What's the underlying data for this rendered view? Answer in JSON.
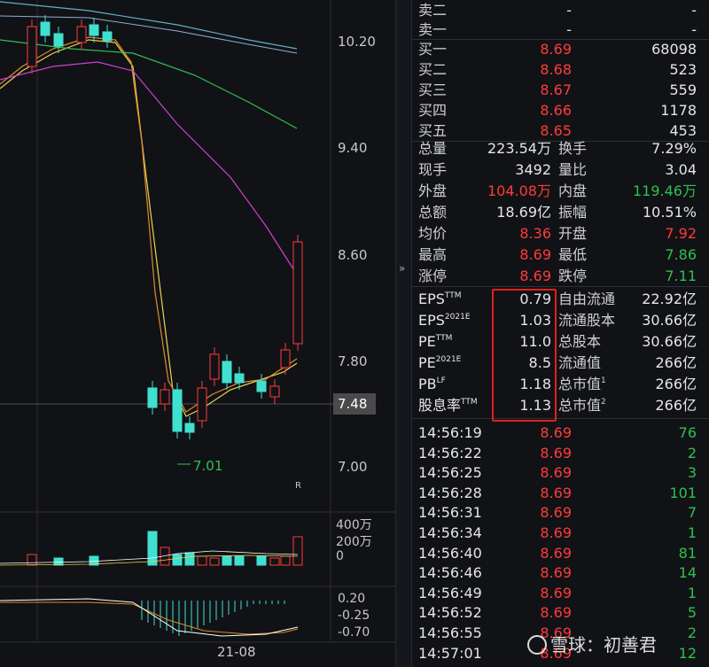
{
  "chart": {
    "price_axis": [
      "10.20",
      "9.40",
      "8.60",
      "7.80",
      "7.00"
    ],
    "current_price": "7.48",
    "low_marker": "7.01",
    "r_mark": "R",
    "volume_axis": [
      "400万",
      "200万",
      "0"
    ],
    "macd_axis": [
      "0.20",
      "-0.25",
      "-0.70"
    ],
    "date": "21-08",
    "colors": {
      "up": "#ff3b3b",
      "down": "#40e0d0",
      "ma5": "#ffffff",
      "ma10": "#e8d44d",
      "ma20": "#d040d0",
      "ma60": "#2ec14f",
      "ma_long": "#5fb0c8"
    }
  },
  "expand_icon": "»",
  "order_book": {
    "asks": [
      {
        "label": "卖二",
        "price": "-",
        "volume": "-"
      },
      {
        "label": "卖一",
        "price": "-",
        "volume": "-"
      }
    ],
    "bids": [
      {
        "label": "买一",
        "price": "8.69",
        "volume": "68098"
      },
      {
        "label": "买二",
        "price": "8.68",
        "volume": "523"
      },
      {
        "label": "买三",
        "price": "8.67",
        "volume": "559"
      },
      {
        "label": "买四",
        "price": "8.66",
        "volume": "1178"
      },
      {
        "label": "买五",
        "price": "8.65",
        "volume": "453"
      }
    ]
  },
  "stats": [
    {
      "l1": "总量",
      "v1": "223.54万",
      "c1": "white",
      "l2": "换手",
      "v2": "7.29%",
      "c2": "white"
    },
    {
      "l1": "现手",
      "v1": "3492",
      "c1": "white",
      "l2": "量比",
      "v2": "3.04",
      "c2": "white"
    },
    {
      "l1": "外盘",
      "v1": "104.08万",
      "c1": "red",
      "l2": "内盘",
      "v2": "119.46万",
      "c2": "green"
    },
    {
      "l1": "总额",
      "v1": "18.69亿",
      "c1": "white",
      "l2": "振幅",
      "v2": "10.51%",
      "c2": "white"
    },
    {
      "l1": "均价",
      "v1": "8.36",
      "c1": "red",
      "l2": "开盘",
      "v2": "7.92",
      "c2": "red"
    },
    {
      "l1": "最高",
      "v1": "8.69",
      "c1": "red",
      "l2": "最低",
      "v2": "7.86",
      "c2": "green"
    },
    {
      "l1": "涨停",
      "v1": "8.69",
      "c1": "red",
      "l2": "跌停",
      "v2": "7.11",
      "c2": "green"
    }
  ],
  "fundamentals": [
    {
      "l1": "EPS",
      "s1": "TTM",
      "v1": "0.79",
      "l2": "自由流通",
      "s2": "",
      "v2": "22.92亿"
    },
    {
      "l1": "EPS",
      "s1": "2021E",
      "v1": "1.03",
      "l2": "流通股本",
      "s2": "",
      "v2": "30.66亿"
    },
    {
      "l1": "PE",
      "s1": "TTM",
      "v1": "11.0",
      "l2": "总股本",
      "s2": "",
      "v2": "30.66亿"
    },
    {
      "l1": "PE",
      "s1": "2021E",
      "v1": "8.5",
      "l2": "流通值",
      "s2": "",
      "v2": "266亿"
    },
    {
      "l1": "PB",
      "s1": "LF",
      "v1": "1.18",
      "l2": "总市值",
      "s2": "1",
      "v2": "266亿"
    },
    {
      "l1": "股息率",
      "s1": "TTM",
      "v1": "1.13",
      "l2": "总市值",
      "s2": "2",
      "v2": "266亿"
    }
  ],
  "ticks": [
    {
      "time": "14:56:19",
      "price": "8.69",
      "vol": "76"
    },
    {
      "time": "14:56:22",
      "price": "8.69",
      "vol": "2"
    },
    {
      "time": "14:56:25",
      "price": "8.69",
      "vol": "3"
    },
    {
      "time": "14:56:28",
      "price": "8.69",
      "vol": "101"
    },
    {
      "time": "14:56:31",
      "price": "8.69",
      "vol": "7"
    },
    {
      "time": "14:56:34",
      "price": "8.69",
      "vol": "1"
    },
    {
      "time": "14:56:40",
      "price": "8.69",
      "vol": "81"
    },
    {
      "time": "14:56:46",
      "price": "8.69",
      "vol": "14"
    },
    {
      "time": "14:56:49",
      "price": "8.69",
      "vol": "1"
    },
    {
      "time": "14:56:52",
      "price": "8.69",
      "vol": "5"
    },
    {
      "time": "14:56:55",
      "price": "8.69",
      "vol": "2"
    },
    {
      "time": "14:57:01",
      "price": "8.69",
      "vol": "12"
    }
  ],
  "watermark": {
    "site": "雪球",
    "sep": "：",
    "author": "初善君"
  }
}
